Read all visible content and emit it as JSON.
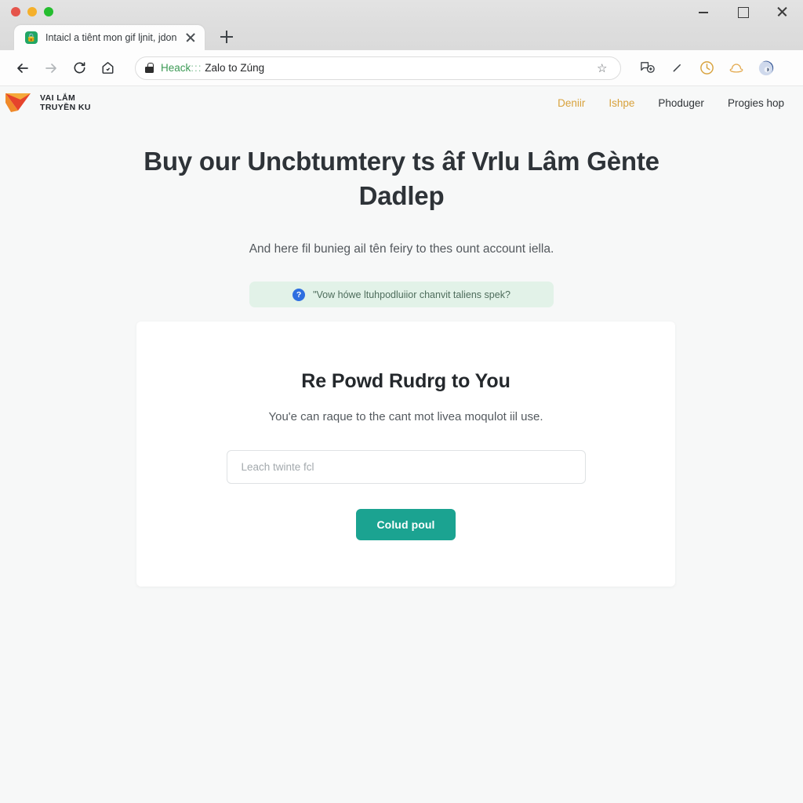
{
  "window": {
    "controls": {
      "minimize": "minimize",
      "maximize": "maximize",
      "close": "close"
    }
  },
  "browser": {
    "tab": {
      "title": "Intaicl a tiênt mon gif ljnit, jdon",
      "favicon": "lock-favicon",
      "close_label": "close-tab"
    },
    "new_tab_label": "new-tab",
    "nav": {
      "back": "back",
      "forward": "forward",
      "reload": "reload",
      "home": "home"
    },
    "url": {
      "scheme_text": "Heack",
      "separator": ":::",
      "address": "Zalo to Zúng",
      "lock_icon": "lock-icon",
      "bookmark_icon": "star-icon"
    },
    "toolbar_icons": [
      "extensions-icon",
      "pen-icon",
      "history-clock-icon",
      "profile-hat-icon",
      "account-avatar-icon"
    ]
  },
  "site": {
    "brand": {
      "line1": "VAI LẮM",
      "line2": "TRUYỀN KU",
      "mark": "triangle-logo-mark",
      "mark_colors": [
        "#ef8a26",
        "#e6442c",
        "#f6b13a"
      ]
    },
    "nav": [
      {
        "label": "Deniir",
        "style": "accent"
      },
      {
        "label": "Ishpe",
        "style": "accent"
      },
      {
        "label": "Phoduger",
        "style": "plain"
      },
      {
        "label": "Progies hop",
        "style": "plain"
      }
    ]
  },
  "hero": {
    "heading": "Buy our Uncbtumtery ts âf Vrlu Lâm Gènte Dadlep",
    "subheading": "And here fil bunieg ail tên feiry to thes ount account iella.",
    "banner": {
      "icon": "question-mark-icon",
      "text": "\"Vow hówe ltuhpodluiior chanvit taliens spek?",
      "background_color": "#e2f2e8",
      "icon_color": "#2f6fe0"
    }
  },
  "card": {
    "title": "Re Powd Rudrg to You",
    "subtitle": "You'e can raque to the cant mot livea moqulot iil use.",
    "input": {
      "placeholder": "Leach twinte fcl",
      "value": ""
    },
    "submit_label": "Colud poul",
    "accent_color": "#1ba391"
  },
  "colors": {
    "page_background": "#f7f8f8",
    "card_background": "#ffffff",
    "nav_accent": "#d8a23c",
    "heading": "#2e3338"
  }
}
